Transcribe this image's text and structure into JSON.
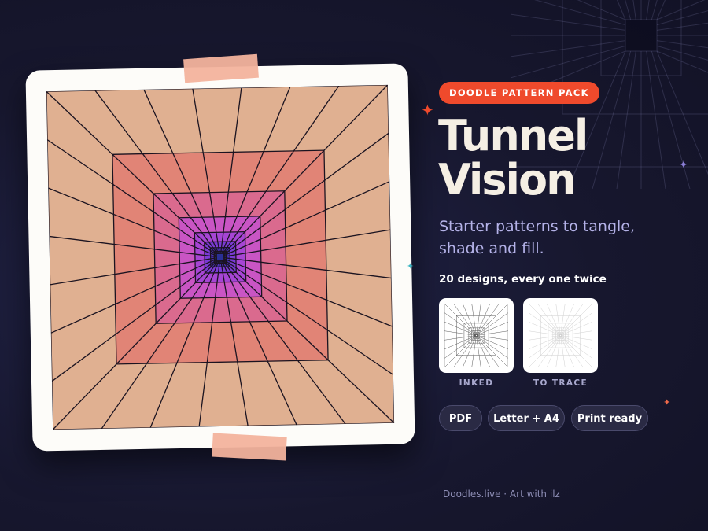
{
  "badge": "DOODLE PATTERN PACK",
  "title": {
    "line1": "Tunnel",
    "line2": "Vision"
  },
  "subtitle": "Starter patterns to tangle, shade and fill.",
  "designs_note": "20 designs, every one twice",
  "thumbnails": [
    {
      "label": "INKED"
    },
    {
      "label": "TO TRACE"
    }
  ],
  "chips": [
    "PDF",
    "Letter + A4",
    "Print ready"
  ],
  "footer": "Doodles.live · Art with ilz",
  "colors": {
    "background": "#17172e",
    "badge": "#ef4a2c",
    "title": "#f5efe4",
    "subtitle": "#b4b2e8",
    "tape": "#f3b39d",
    "ring_gradient": [
      "#e0b091",
      "#e18476",
      "#da6a8e",
      "#c955c4",
      "#a645d4",
      "#7a3bd4",
      "#4a32b8",
      "#2a3096"
    ]
  },
  "icons": [
    "four-point-star-icon"
  ]
}
